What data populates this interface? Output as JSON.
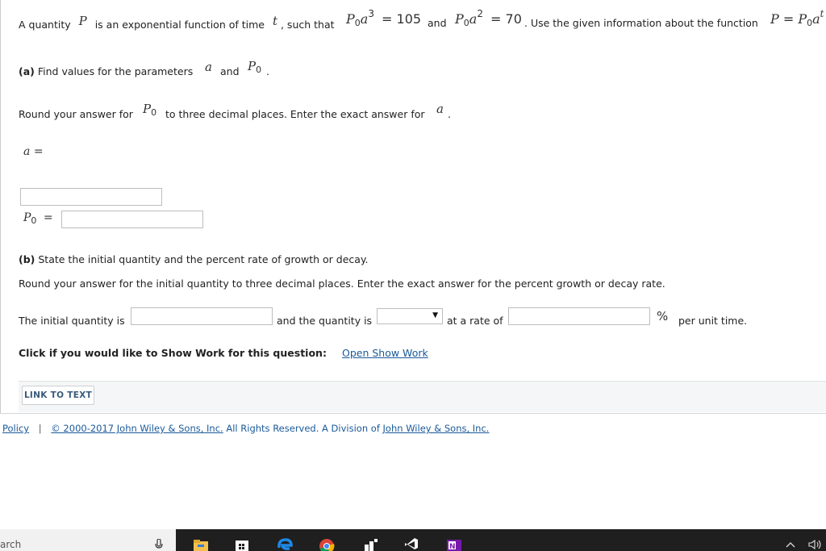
{
  "intro": {
    "p1": "A quantity",
    "var_P": "P",
    "p2": "is an exponential function of time",
    "var_t": "t",
    "p3": ", such that",
    "eq1_left": "P",
    "eq1_sub": "0",
    "eq1_a": "a",
    "eq1_exp": "3",
    "eq1_rhs": "= 105",
    "and": "and",
    "eq2_left": "P",
    "eq2_sub": "0",
    "eq2_a": "a",
    "eq2_exp": "2",
    "eq2_rhs": "= 70",
    "p4": ". Use the given information about the function",
    "fn_P": "P",
    "fn_eq": "=",
    "fn_P0": "P",
    "fn_sub": "0",
    "fn_a": "a",
    "fn_exp": "t"
  },
  "part_a": {
    "label": "(a)",
    "text1": "Find values for the parameters",
    "var_a": "a",
    "and": "and",
    "var_P": "P",
    "var_sub": "0",
    "end": ".",
    "round1": "Round your answer for",
    "round_P": "P",
    "round_sub": "0",
    "round2": "to three decimal places. Enter the exact answer for",
    "round_a": "a",
    "round_end": ".",
    "a_label_var": "a",
    "a_label_eq": "=",
    "p0_label_var": "P",
    "p0_label_sub": "0",
    "p0_label_eq": "=",
    "a_value": "",
    "p0_value": ""
  },
  "part_b": {
    "label": "(b)",
    "text": "State the initial quantity and the percent rate of growth or decay.",
    "round": "Round your answer for the initial quantity to three decimal places. Enter the exact answer for the percent growth or decay rate.",
    "initial_label": "The initial quantity is",
    "initial_value": "",
    "quantity_label": "and the quantity is",
    "quantity_selected": "",
    "rate_label": "at a rate of",
    "rate_value": "",
    "percent": "%",
    "per_unit": "per unit time."
  },
  "show_work": {
    "prompt": "Click if you would like to Show Work for this question:",
    "link": "Open Show Work"
  },
  "link_to_text": "LINK TO TEXT",
  "footer": {
    "policy": "Policy",
    "sep": "|",
    "copyright": "© 2000-2017 John Wiley & Sons, Inc.",
    "rights": "All Rights Reserved. A Division of",
    "company": "John Wiley & Sons, Inc."
  },
  "taskbar": {
    "search_text": "arch",
    "icons": [
      "microphone-icon",
      "file-explorer-icon",
      "store-icon",
      "edge-icon",
      "chrome-icon",
      "app-icon",
      "visual-studio-icon",
      "onenote-icon"
    ],
    "tray": [
      "chevron-up-icon",
      "speaker-icon"
    ]
  }
}
